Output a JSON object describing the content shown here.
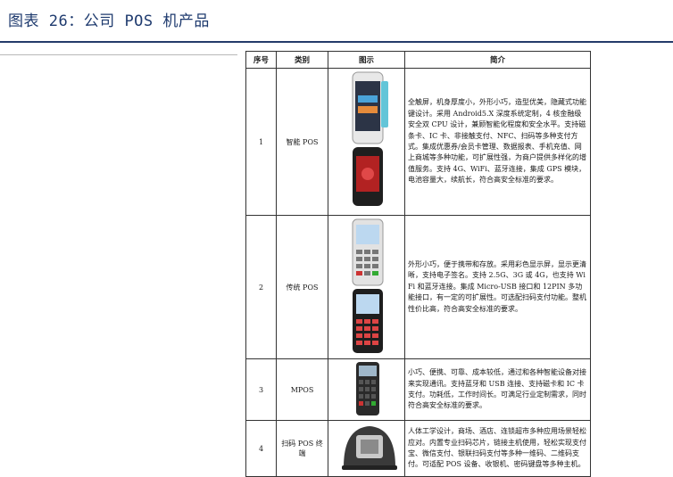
{
  "title": "图表 26：公司 POS 机产品",
  "table": {
    "headers": [
      "序号",
      "类别",
      "图示",
      "简介"
    ],
    "rows": [
      {
        "num": "1",
        "category": "智能 POS",
        "desc": "全触屏，机身厚度小，外形小巧，造型优美，隐藏式功能键设计。采用 Android5.X 深度系统定制，4 核金融级安全双 CPU 设计，兼顾智能化程度和安全水平。支持磁条卡、IC 卡、非接触支付、NFC、扫码等多种支付方式。集成优惠券/会员卡管理、数据报表、手机充值、网上商城等多种功能，可扩展性强，为商户提供多样化的增值服务。支持 4G、WiFi、蓝牙连接，集成 GPS 模块，电池容量大，续航长，符合高安全标准的要求。"
      },
      {
        "num": "2",
        "category": "传统 POS",
        "desc": "外形小巧，便于携带和存放。采用彩色显示屏，显示更清晰，支持电子签名。支持 2.5G、3G 或 4G，也支持 WiFi 和蓝牙连接。集成 Micro-USB 接口和 12PIN 多功能接口，有一定的可扩展性。可选配扫码支付功能。整机性价比高，符合高安全标准的要求。"
      },
      {
        "num": "3",
        "category": "MPOS",
        "desc": "小巧、便携、可靠、成本较低，通过和各种智能设备对接来实现通讯。支持蓝牙和 USB 连接、支持磁卡和 IC 卡支付。功耗低，工作时间长。可满足行业定制需求，同时符合高安全标准的要求。"
      },
      {
        "num": "4",
        "category": "扫码 POS 终端",
        "desc": "人体工学设计，商场、酒店、连锁超市多种应用场景轻松应对。内置专业扫码芯片，链接主机使用，轻松实现支付宝、微信支付、银联扫码支付等多种一维码、二维码支付。可适配 POS 设备、收银机、密码键盘等多种主机。"
      }
    ]
  }
}
